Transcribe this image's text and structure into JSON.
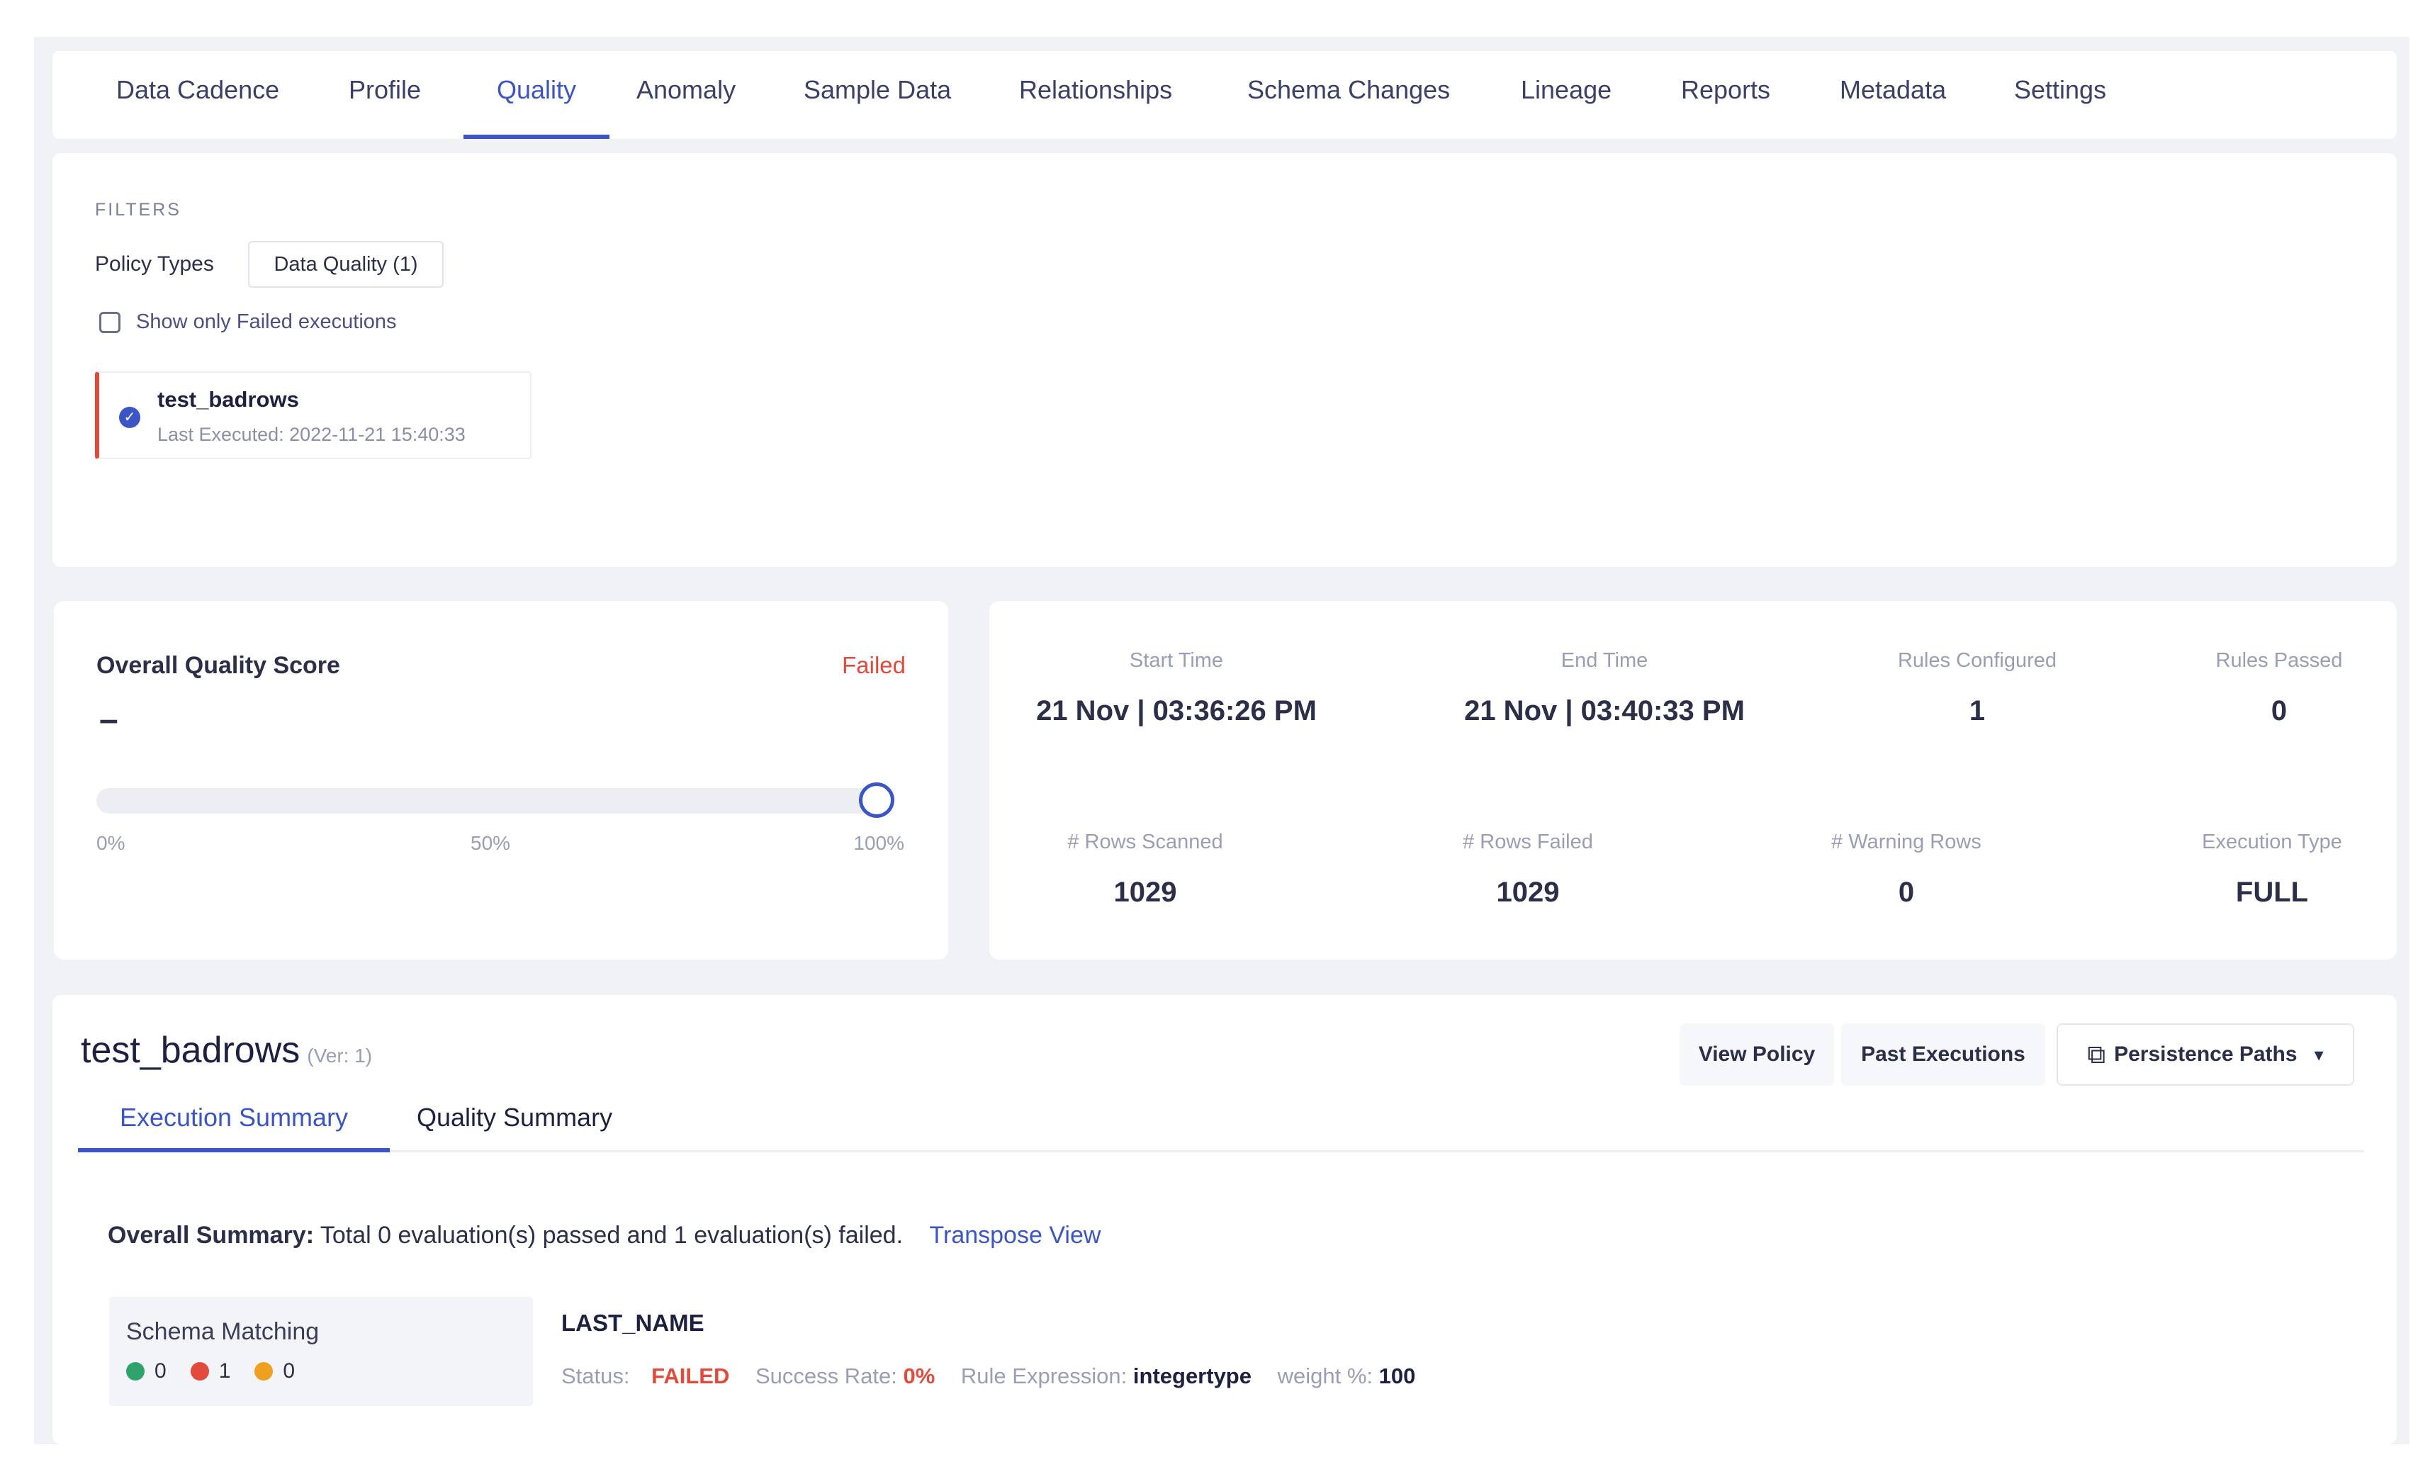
{
  "nav": {
    "tabs": [
      {
        "label": "Data Cadence"
      },
      {
        "label": "Profile"
      },
      {
        "label": "Quality"
      },
      {
        "label": "Anomaly"
      },
      {
        "label": "Sample Data"
      },
      {
        "label": "Relationships"
      },
      {
        "label": "Schema Changes"
      },
      {
        "label": "Lineage"
      },
      {
        "label": "Reports"
      },
      {
        "label": "Metadata"
      },
      {
        "label": "Settings"
      }
    ],
    "active": "Quality"
  },
  "filters": {
    "title": "FILTERS",
    "policy_types_label": "Policy Types",
    "policy_types_value": "Data Quality (1)",
    "failed_only_label": "Show only Failed executions",
    "failed_only_checked": false,
    "policy": {
      "name": "test_badrows",
      "last_executed": "Last Executed: 2022-11-21 15:40:33"
    }
  },
  "score": {
    "title": "Overall Quality Score",
    "status": "Failed",
    "value": "–",
    "slider_percent": 100,
    "ticks": [
      "0%",
      "50%",
      "100%"
    ]
  },
  "stats": {
    "start_time_label": "Start Time",
    "start_time": "21 Nov | 03:36:26 PM",
    "end_time_label": "End Time",
    "end_time": "21 Nov | 03:40:33 PM",
    "rules_configured_label": "Rules Configured",
    "rules_configured": "1",
    "rules_passed_label": "Rules Passed",
    "rules_passed": "0",
    "rows_scanned_label": "# Rows Scanned",
    "rows_scanned": "1029",
    "rows_failed_label": "# Rows Failed",
    "rows_failed": "1029",
    "warning_rows_label": "# Warning Rows",
    "warning_rows": "0",
    "execution_type_label": "Execution Type",
    "execution_type": "FULL"
  },
  "detail": {
    "policy_name": "test_badrows",
    "version": "(Ver: 1)",
    "view_policy": "View Policy",
    "past_executions": "Past Executions",
    "persistence_paths": "Persistence Paths",
    "tabs": {
      "execution_summary": "Execution Summary",
      "quality_summary": "Quality Summary"
    },
    "overall_summary_label": "Overall Summary:",
    "overall_summary_text": "Total 0 evaluation(s) passed and 1 evaluation(s) failed.",
    "transpose_view": "Transpose View",
    "rule": {
      "title": "Schema Matching",
      "passed": "0",
      "failed": "1",
      "warning": "0",
      "column": "LAST_NAME",
      "status_label": "Status:",
      "status": "FAILED",
      "success_rate_label": "Success Rate:",
      "success_rate": "0%",
      "expression_label": "Rule Expression:",
      "expression": "integertype",
      "weight_label": "weight %:",
      "weight": "100"
    }
  },
  "colors": {
    "accent": "#3b56c4",
    "failed": "#e24a3b",
    "pass": "#2fa36b",
    "warn": "#f0a020"
  }
}
